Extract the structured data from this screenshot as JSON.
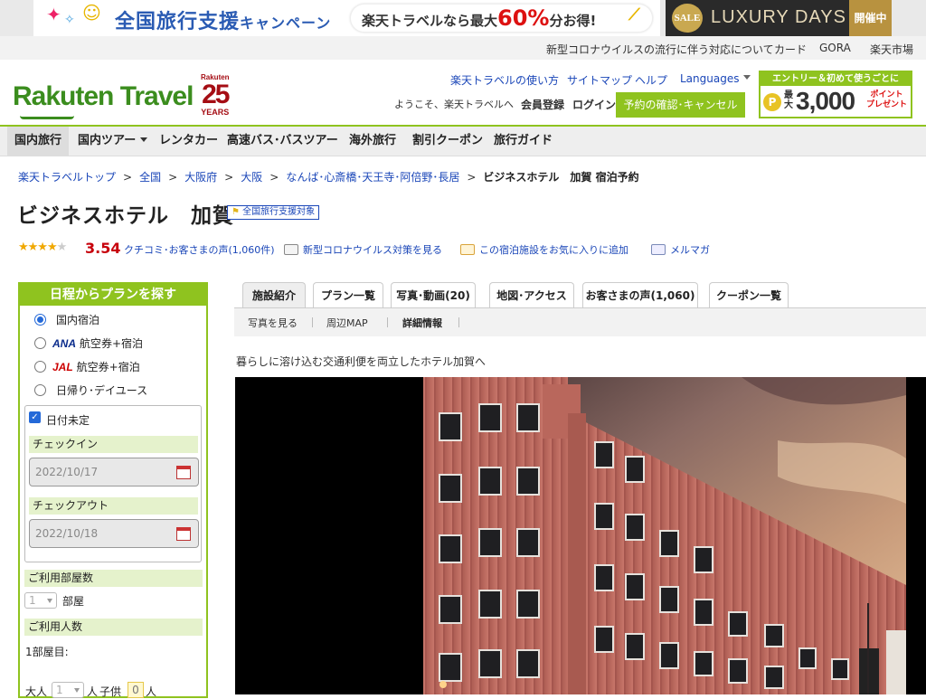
{
  "banner": {
    "campaign": "全国旅行支援",
    "campaign_suffix": "キャンペーン",
    "pill_pre": "楽天トラベルなら最大",
    "pill_pct": "60%",
    "pill_post": "分お得!",
    "lux_sale": "SALE",
    "lux_title": "LUXURY DAYS",
    "lux_open": "開催中"
  },
  "utility": {
    "links": [
      "新型コロナウイルスの流行に伴う対応について",
      "カード",
      "GORA",
      "楽天市場"
    ]
  },
  "header": {
    "logo": "Rakuten Travel",
    "anniv_brand": "Rakuten",
    "anniv_num": "25",
    "anniv_years": "YEARS",
    "help_links": [
      "楽天トラベルの使い方",
      "サイトマップ",
      "ヘルプ"
    ],
    "languages": "Languages",
    "welcome": "ようこそ、楽天トラベルへ",
    "register": "会員登録",
    "login": "ログイン",
    "reservation_btn": "予約の確認･キャンセル",
    "promo_title": "エントリー＆初めて使うごとに",
    "promo_coin": "P",
    "promo_max": "最大",
    "promo_amount": "3,000",
    "promo_pt": "ポイント",
    "promo_present": "プレゼント"
  },
  "gnav": {
    "items": [
      "国内旅行",
      "国内ツアー",
      "レンタカー",
      "高速バス･バスツアー",
      "海外旅行",
      "割引クーポン",
      "旅行ガイド"
    ]
  },
  "breadcrumb": {
    "items": [
      "楽天トラベルトップ",
      "全国",
      "大阪府",
      "大阪",
      "なんば･心斎橋･天王寺･阿倍野･長居"
    ],
    "sep": ">",
    "current": "ビジネスホテル　加賀 宿泊予約"
  },
  "hotel": {
    "name": "ビジネスホテル　加賀",
    "badge": "全国旅行支援対象",
    "stars": "★★★★",
    "star_off": "★",
    "rating_value": 3.54,
    "rating": "3.54",
    "reviews_link": "クチコミ･お客さまの声(1,060件)",
    "covid_link": "新型コロナウイルス対策を見る",
    "fav_link": "この宿泊施設をお気に入りに追加",
    "mail_link": "メルマガ"
  },
  "search": {
    "title": "日程からプランを探す",
    "options": [
      {
        "label": "国内宿泊",
        "selected": true,
        "airline": ""
      },
      {
        "label": "航空券+宿泊",
        "selected": false,
        "airline": "ANA"
      },
      {
        "label": "航空券+宿泊",
        "selected": false,
        "airline": "JAL"
      },
      {
        "label": "日帰り･デイユース",
        "selected": false,
        "airline": ""
      }
    ],
    "undecided_label": "日付未定",
    "checkin_label": "チェックイン",
    "checkin_value": "2022/10/17",
    "checkout_label": "チェックアウト",
    "checkout_value": "2022/10/18",
    "rooms_label": "ご利用部屋数",
    "rooms_value": "1",
    "rooms_unit": "部屋",
    "people_label": "ご利用人数",
    "room1_label": "1部屋目:",
    "adult_label": "大人",
    "adult_value": "1",
    "adult_unit": "人",
    "child_label": "子供",
    "child_value": "0",
    "child_unit": "人"
  },
  "tabs": [
    "施設紹介",
    "プラン一覧",
    "写真･動画(20)",
    "地図･アクセス",
    "お客さまの声(1,060)",
    "クーポン一覧"
  ],
  "subnav": [
    "写真を見る",
    "周辺MAP",
    "詳細情報"
  ],
  "catchcopy": "暮らしに溶け込む交通利便を両立したホテル加賀へ",
  "colors": {
    "accent": "#8fc31f",
    "link": "#1a46b8",
    "price_red": "#c7000b",
    "logo_green": "#3b8d1e"
  }
}
